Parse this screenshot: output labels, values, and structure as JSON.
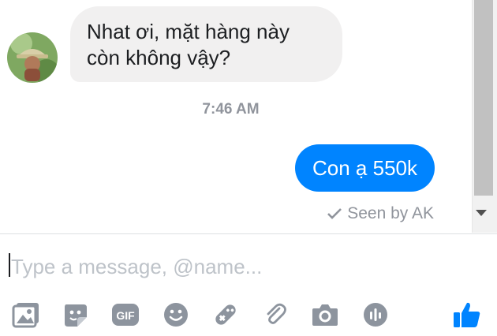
{
  "conversation": {
    "incoming": {
      "lines": [
        "Nhat ơi, mặt hàng này",
        "còn không vậy?"
      ]
    },
    "timestamp": "7:46 AM",
    "outgoing": {
      "text": "Con ạ 550k"
    },
    "seen": "Seen by AK"
  },
  "composer": {
    "placeholder": "Type a message, @name..."
  },
  "toolbar": {
    "gif_label": "GIF",
    "icons": [
      "image-icon",
      "sticker-icon",
      "gif-icon",
      "emoji-icon",
      "game-controller-icon",
      "paperclip-icon",
      "camera-icon",
      "voice-clip-icon",
      "thumbs-up-icon"
    ]
  },
  "colors": {
    "accent": "#0084ff",
    "incoming_bubble": "#f1f0f0",
    "muted_text": "#90949c",
    "toolbar_icon": "#8d949e"
  }
}
